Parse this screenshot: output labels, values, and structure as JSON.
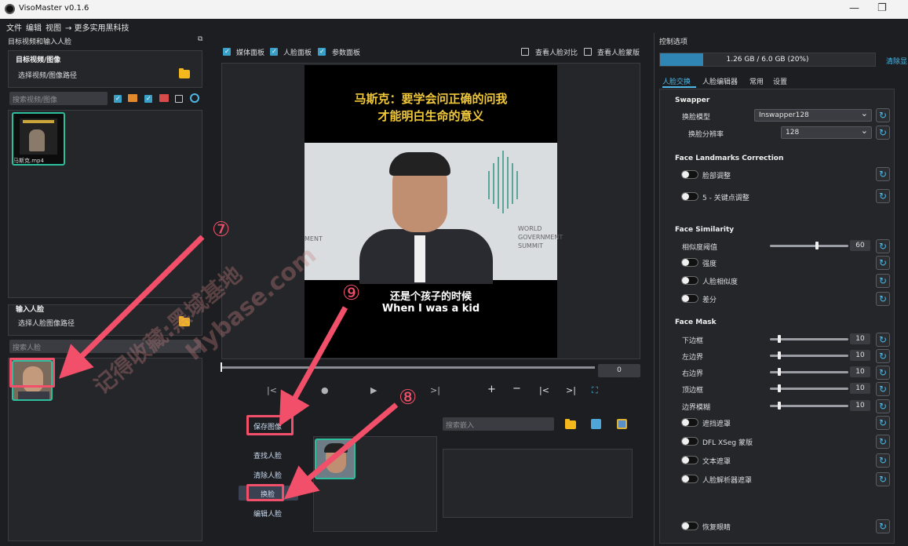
{
  "window": {
    "title": "VisoMaster v0.1.6",
    "minimize": "—",
    "maximize": "❐"
  },
  "menu": [
    "文件",
    "编辑",
    "视图",
    "→ 更多实用黑科技"
  ],
  "left_panel": {
    "header": "目标视频和输入人脸",
    "target_group_title": "目标视频/图像",
    "target_path_label": "选择视频/图像路径",
    "search_target_placeholder": "搜索视频/图像",
    "video_thumb_caption": "马斯克.mp4",
    "input_group_title": "输入人脸",
    "input_path_label": "选择人脸图像路径",
    "search_face_placeholder": "搜索人脸"
  },
  "center": {
    "checkboxes": [
      {
        "label": "媒体面板",
        "checked": true
      },
      {
        "label": "人脸面板",
        "checked": true
      },
      {
        "label": "参数面板",
        "checked": true
      }
    ],
    "right_checkboxes": [
      {
        "label": "查看人脸对比",
        "checked": false
      },
      {
        "label": "查看人脸蒙版",
        "checked": false
      }
    ],
    "video_caption_top_line1": "马斯克：要学会问正确的问我",
    "video_caption_top_line2": "才能明白生命的意义",
    "video_caption_bottom_cn": "还是个孩子的时候",
    "video_caption_bottom_en": "When I was a kid",
    "backdrop_text_1": "WORLD",
    "backdrop_text_2": "GOVERNMENT",
    "backdrop_text_3": "SUMMIT",
    "backdrop_text_left": "MENT",
    "frame_number": "0",
    "buttons": {
      "save_image": "保存图像",
      "find_faces": "查找人脸",
      "clear_faces": "清除人脸",
      "swap_faces": "换脸",
      "edit_faces": "编辑人脸"
    },
    "search_embed_placeholder": "搜索嵌入"
  },
  "annotations": {
    "seven": "⑦",
    "eight": "⑧",
    "nine": "⑨",
    "watermark_1": "记得收藏:黑域基地",
    "watermark_2": "Hybase.com"
  },
  "right_panel": {
    "header": "控制选项",
    "memory": {
      "text": "1.26 GB / 6.0 GB (20%)",
      "percent": 20
    },
    "clear_vram": "清除显",
    "tabs": [
      "人脸交换",
      "人脸编辑器",
      "常用",
      "设置"
    ],
    "swapper_title": "Swapper",
    "model_label": "换脸模型",
    "model_value": "Inswapper128",
    "resolution_label": "换脸分辨率",
    "resolution_value": "128",
    "landmarks_title": "Face Landmarks Correction",
    "landmarks_items": [
      "脸部调整",
      "5 - 关键点调整"
    ],
    "similarity_title": "Face Similarity",
    "similarity_threshold_label": "相似度阈值",
    "similarity_threshold_value": "60",
    "similarity_threshold_fraction": 0.6,
    "similarity_toggles": [
      "强度",
      "人脸相似度",
      "差分"
    ],
    "mask_title": "Face Mask",
    "mask_sliders": [
      {
        "label": "下边框",
        "value": "10"
      },
      {
        "label": "左边界",
        "value": "10"
      },
      {
        "label": "右边界",
        "value": "10"
      },
      {
        "label": "顶边框",
        "value": "10"
      },
      {
        "label": "边界模糊",
        "value": "10"
      }
    ],
    "mask_toggles": [
      "遮挡遮罩",
      "DFL XSeg 蒙版",
      "文本遮罩",
      "人脸解析器遮罩"
    ],
    "restore_eyes": "恢复眼睛"
  },
  "colors": {
    "accent": "#3aa0c8",
    "annotation": "#f2506a",
    "thumb_border": "#2bbf9d"
  }
}
